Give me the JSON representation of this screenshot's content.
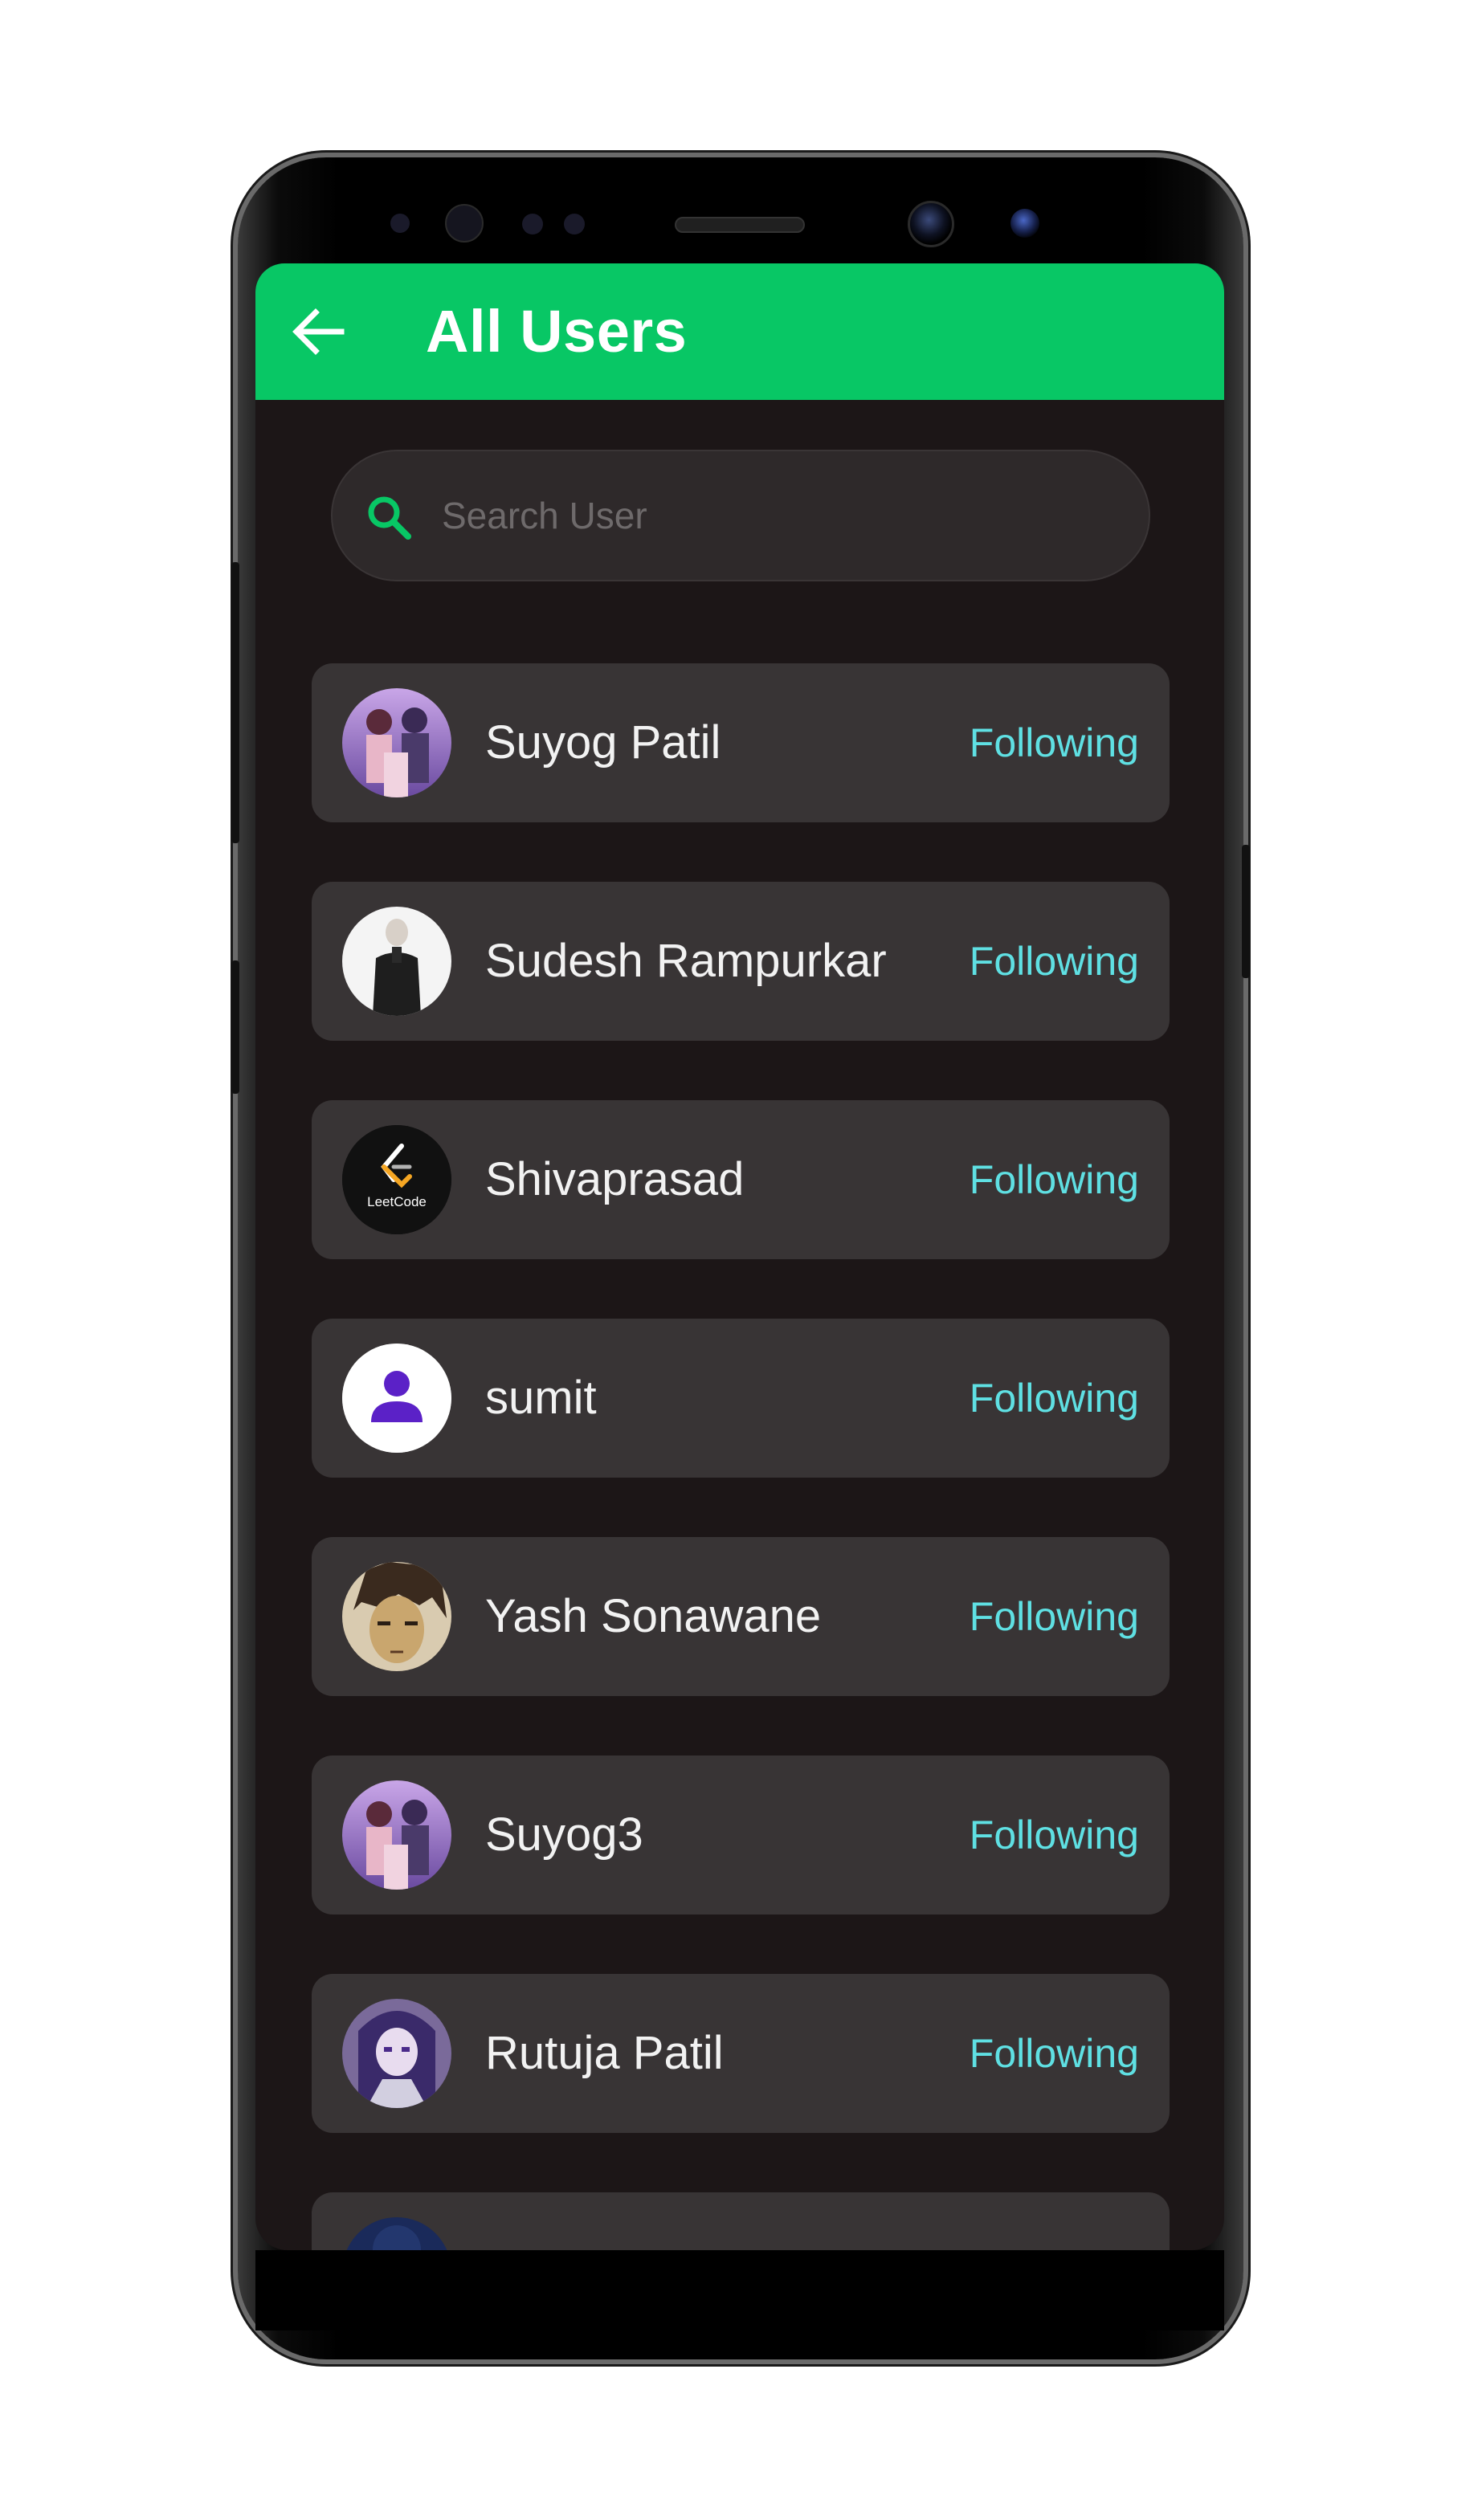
{
  "appbar": {
    "title": "All Users"
  },
  "search": {
    "placeholder": "Search User",
    "value": ""
  },
  "icons": {
    "back": "arrow-left-icon",
    "search": "search-icon"
  },
  "colors": {
    "appbar": "#08c765",
    "screen_bg": "#1c1617",
    "card_bg": "#383435",
    "follow_text": "#5fe0e3",
    "search_icon": "#08c765"
  },
  "users": [
    {
      "name": "Suyog Patil",
      "action": "Following",
      "avatar": "anime-group"
    },
    {
      "name": "Sudesh Rampurkar",
      "action": "Following",
      "avatar": "person-suit"
    },
    {
      "name": "Shivaprasad",
      "action": "Following",
      "avatar": "leetcode-logo",
      "avatar_text": "LeetCode"
    },
    {
      "name": "sumit",
      "action": "Following",
      "avatar": "default-user"
    },
    {
      "name": "Yash Sonawane",
      "action": "Following",
      "avatar": "anime-face"
    },
    {
      "name": "Suyog3",
      "action": "Following",
      "avatar": "anime-group"
    },
    {
      "name": "Rutuja Patil",
      "action": "Following",
      "avatar": "anime-purple"
    },
    {
      "name": "",
      "action": "",
      "avatar": "partial-dark"
    }
  ]
}
